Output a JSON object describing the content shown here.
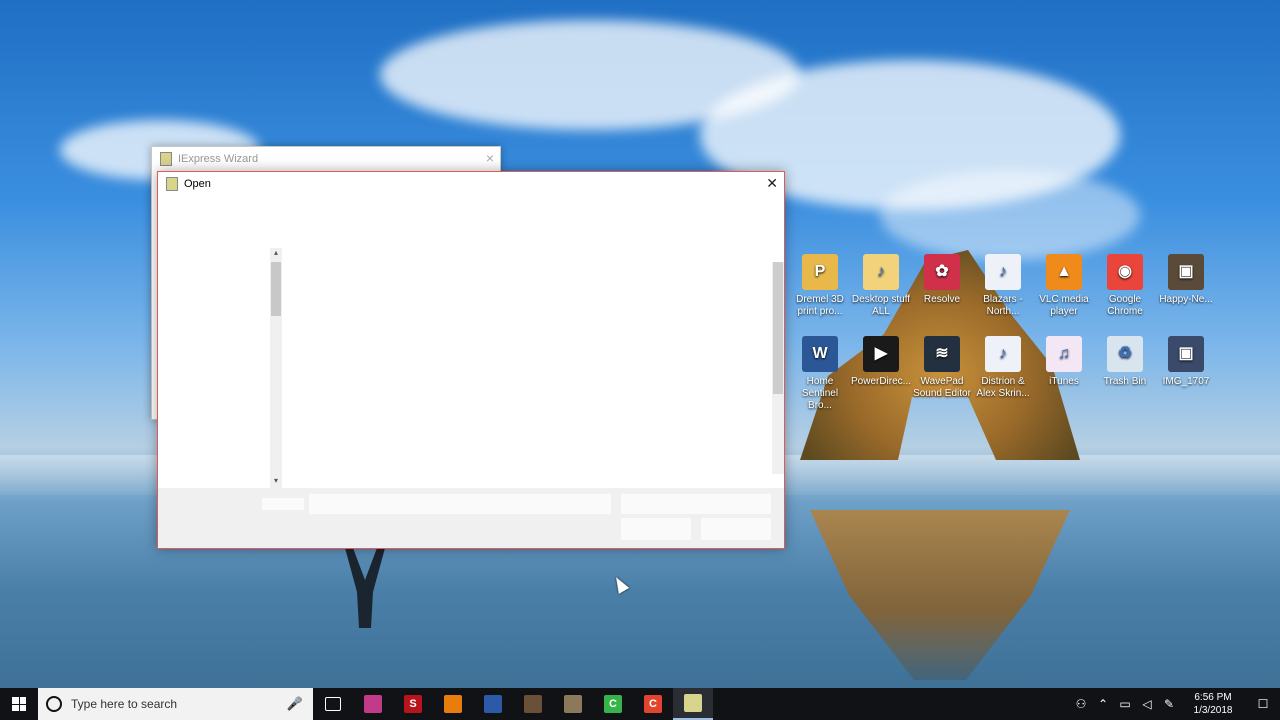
{
  "iexpress_window": {
    "title": "IExpress Wizard",
    "close_icon": "×"
  },
  "open_dialog": {
    "title": "Open",
    "close_icon": "✕",
    "scroll_up": "▴",
    "scroll_down": "▾"
  },
  "desktop_icons": [
    {
      "label": "Dremel 3D print pro...",
      "glyph": "P",
      "color": "#e8b84a",
      "icon": "dremel-app-icon"
    },
    {
      "label": "Desktop stuff ALL",
      "glyph": "♪",
      "color": "#f2d27a",
      "icon": "folder-icon"
    },
    {
      "label": "Resolve",
      "glyph": "✿",
      "color": "#d0304a",
      "icon": "davinci-resolve-icon"
    },
    {
      "label": "Blazars - North...",
      "glyph": "♪",
      "color": "#eef2f8",
      "icon": "mp3-file-icon"
    },
    {
      "label": "VLC media player",
      "glyph": "▲",
      "color": "#f08a1a",
      "icon": "vlc-icon"
    },
    {
      "label": "Google Chrome",
      "glyph": "◉",
      "color": "#e9453a",
      "icon": "chrome-icon"
    },
    {
      "label": "Happy-Ne...",
      "glyph": "▣",
      "color": "#5a4a3a",
      "icon": "image-thumbnail-icon"
    },
    {
      "label": "Home Sentinel Bro...",
      "glyph": "W",
      "color": "#2b5797",
      "icon": "word-doc-icon"
    },
    {
      "label": "PowerDirec...",
      "glyph": "▶",
      "color": "#1a1a1a",
      "icon": "powerdirector-icon"
    },
    {
      "label": "WavePad Sound Editor",
      "glyph": "≋",
      "color": "#22303f",
      "icon": "wavepad-icon"
    },
    {
      "label": "Distrion & Alex Skrin...",
      "glyph": "♪",
      "color": "#eef2f8",
      "icon": "mp3-file-icon"
    },
    {
      "label": "iTunes",
      "glyph": "♫",
      "color": "#f3e6f5",
      "icon": "itunes-icon"
    },
    {
      "label": "Trash Bin",
      "glyph": "♻",
      "color": "#d8e4ee",
      "icon": "recycle-bin-icon"
    },
    {
      "label": "IMG_1707",
      "glyph": "▣",
      "color": "#3a4a6a",
      "icon": "image-thumbnail-icon"
    }
  ],
  "taskbar": {
    "search_placeholder": "Type here to search",
    "mic_icon": "🎤",
    "apps": [
      {
        "name": "task-view-icon",
        "color": "#101215",
        "glyph": "⧉"
      },
      {
        "name": "photos-app-icon",
        "color": "#c23a8a",
        "glyph": ""
      },
      {
        "name": "s-app-icon",
        "color": "#b8141c",
        "glyph": "S"
      },
      {
        "name": "blender-icon",
        "color": "#e87d0d",
        "glyph": ""
      },
      {
        "name": "editor-app-icon",
        "color": "#2d5aa8",
        "glyph": ""
      },
      {
        "name": "box-app-icon",
        "color": "#6a5036",
        "glyph": ""
      },
      {
        "name": "cube-app-icon",
        "color": "#8a7a5a",
        "glyph": ""
      },
      {
        "name": "camtasia-green-icon",
        "color": "#36b34a",
        "glyph": "C"
      },
      {
        "name": "camtasia-red-icon",
        "color": "#e2452f",
        "glyph": "C"
      },
      {
        "name": "iexpress-taskbar-icon",
        "color": "#d8d48c",
        "glyph": ""
      }
    ],
    "clock_time": "6:56 PM",
    "clock_date": "1/3/2018",
    "notification_icon": "☐"
  }
}
